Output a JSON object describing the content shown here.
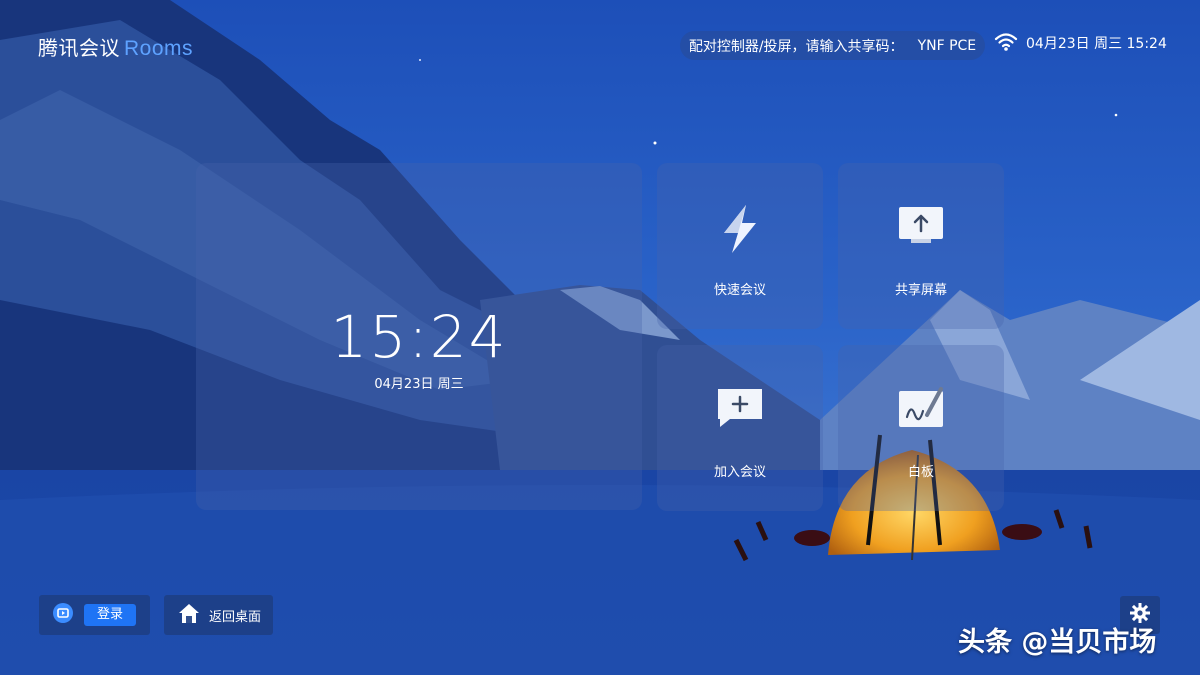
{
  "brand": {
    "name": "腾讯会议",
    "suffix": "Rooms"
  },
  "header": {
    "pair_prompt": "配对控制器/投屏，请输入共享码：",
    "share_code": "YNF PCE",
    "datetime": "04月23日 周三 15:24"
  },
  "clock": {
    "time": "15:24",
    "date": "04月23日 周三"
  },
  "actions": [
    {
      "label": "快速会议",
      "icon": "lightning-icon"
    },
    {
      "label": "共享屏幕",
      "icon": "share-screen-icon"
    },
    {
      "label": "加入会议",
      "icon": "join-meeting-icon"
    },
    {
      "label": "白板",
      "icon": "whiteboard-icon"
    }
  ],
  "footer": {
    "login_label": "登录",
    "desktop_label": "返回桌面"
  },
  "watermark": "头条 @当贝市场",
  "colors": {
    "accent": "#1f74f5",
    "brand_rooms": "#5ea2ff",
    "background": "#0d2f78"
  }
}
